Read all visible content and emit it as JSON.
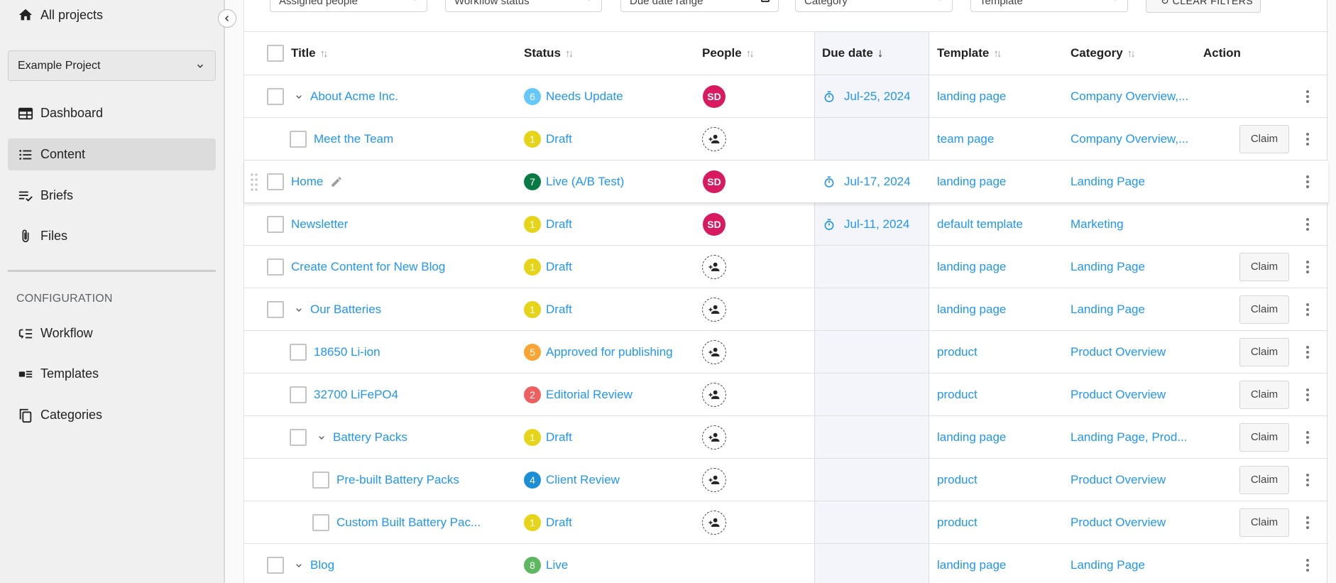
{
  "sidebar": {
    "all_projects": "All projects",
    "project_select": "Example Project",
    "nav": [
      {
        "label": "Dashboard",
        "icon": "dashboard-icon",
        "active": false
      },
      {
        "label": "Content",
        "icon": "list-icon",
        "active": true
      },
      {
        "label": "Briefs",
        "icon": "checklist-icon",
        "active": false
      },
      {
        "label": "Files",
        "icon": "paperclip-icon",
        "active": false
      }
    ],
    "section_title": "CONFIGURATION",
    "config_nav": [
      {
        "label": "Workflow",
        "icon": "workflow-icon"
      },
      {
        "label": "Templates",
        "icon": "templates-icon"
      },
      {
        "label": "Categories",
        "icon": "categories-icon"
      }
    ]
  },
  "filters": {
    "assigned_people": "Assigned people",
    "workflow_status": "Workflow status",
    "due_date_range": "Due date range",
    "category": "Category",
    "template": "Template",
    "clear": "CLEAR FILTERS"
  },
  "table": {
    "headers": {
      "title": "Title",
      "status": "Status",
      "people": "People",
      "due_date": "Due date",
      "template": "Template",
      "category": "Category",
      "action": "Action"
    },
    "claim_label": "Claim",
    "status_colors": {
      "1": "#e6d419",
      "2": "#ef5f5f",
      "4": "#1b8fd6",
      "5": "#f9a533",
      "6": "#64c8fa",
      "7": "#0a7a44",
      "8": "#5db85f"
    },
    "rows": [
      {
        "title": "About Acme Inc.",
        "level": 0,
        "expandable": true,
        "status_num": "6",
        "status": "Needs Update",
        "person": "SD",
        "due": "Jul-25, 2024",
        "template": "landing page",
        "category": "Company Overview,...",
        "claim": false
      },
      {
        "title": "Meet the Team",
        "level": 1,
        "expandable": false,
        "status_num": "1",
        "status": "Draft",
        "person": "",
        "due": "",
        "template": "team page",
        "category": "Company Overview,...",
        "claim": true
      },
      {
        "title": "Home",
        "level": 0,
        "expandable": false,
        "hover": true,
        "status_num": "7",
        "status": "Live (A/B Test)",
        "person": "SD",
        "due": "Jul-17, 2024",
        "template": "landing page",
        "category": "Landing Page",
        "claim": false
      },
      {
        "title": "Newsletter",
        "level": 0,
        "expandable": false,
        "status_num": "1",
        "status": "Draft",
        "person": "SD",
        "due": "Jul-11, 2024",
        "template": "default template",
        "category": "Marketing",
        "claim": false
      },
      {
        "title": "Create Content for New Blog",
        "level": 0,
        "expandable": false,
        "status_num": "1",
        "status": "Draft",
        "person": "",
        "due": "",
        "template": "landing page",
        "category": "Landing Page",
        "claim": true
      },
      {
        "title": "Our Batteries",
        "level": 0,
        "expandable": true,
        "status_num": "1",
        "status": "Draft",
        "person": "",
        "due": "",
        "template": "landing page",
        "category": "Landing Page",
        "claim": true
      },
      {
        "title": "18650 Li-ion",
        "level": 1,
        "expandable": false,
        "status_num": "5",
        "status": "Approved for publishing",
        "person": "",
        "due": "",
        "template": "product",
        "category": "Product Overview",
        "claim": true
      },
      {
        "title": "32700 LiFePO4",
        "level": 1,
        "expandable": false,
        "status_num": "2",
        "status": "Editorial Review",
        "person": "",
        "due": "",
        "template": "product",
        "category": "Product Overview",
        "claim": true
      },
      {
        "title": "Battery Packs",
        "level": 1,
        "expandable": true,
        "status_num": "1",
        "status": "Draft",
        "person": "",
        "due": "",
        "template": "landing page",
        "category": "Landing Page, Prod...",
        "claim": true
      },
      {
        "title": "Pre-built Battery Packs",
        "level": 2,
        "expandable": false,
        "status_num": "4",
        "status": "Client Review",
        "person": "",
        "due": "",
        "template": "product",
        "category": "Product Overview",
        "claim": true
      },
      {
        "title": "Custom Built Battery Pac...",
        "level": 2,
        "expandable": false,
        "status_num": "1",
        "status": "Draft",
        "person": "",
        "due": "",
        "template": "product",
        "category": "Product Overview",
        "claim": true
      },
      {
        "title": "Blog",
        "level": 0,
        "expandable": true,
        "status_num": "8",
        "status": "Live",
        "person": "",
        "due": "",
        "template": "landing page",
        "category": "Landing Page",
        "claim": false,
        "no_people": true
      }
    ]
  }
}
